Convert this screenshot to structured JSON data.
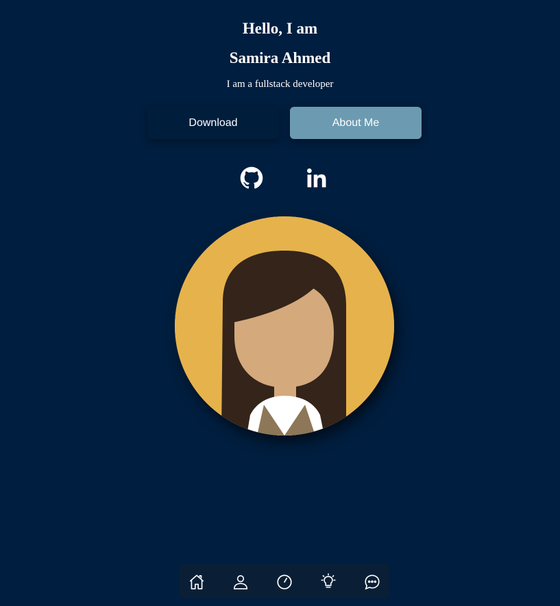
{
  "hero": {
    "greeting": "Hello, I am",
    "name": "Samira Ahmed",
    "role": "I am a fullstack developer"
  },
  "buttons": {
    "download_label": "Download",
    "about_label": "About Me"
  },
  "social": [
    {
      "icon": "github-icon"
    },
    {
      "icon": "linkedin-icon"
    }
  ],
  "avatar": {
    "icon": "avatar-illustration"
  },
  "nav": [
    {
      "icon": "home-icon"
    },
    {
      "icon": "user-icon"
    },
    {
      "icon": "progress-icon"
    },
    {
      "icon": "lightbulb-icon"
    },
    {
      "icon": "chat-icon"
    }
  ],
  "colors": {
    "background": "#001e3f",
    "download_button": "#001d3c",
    "about_button": "#6c9bb1",
    "avatar_background": "#e6b24b",
    "navbar": "#0a1f36"
  }
}
